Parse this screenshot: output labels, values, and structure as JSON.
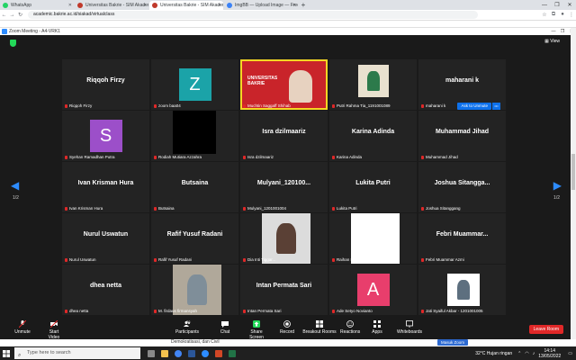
{
  "browser": {
    "tabs": [
      {
        "title": "WhatsApp",
        "color": "#25d366",
        "active": false
      },
      {
        "title": "Universitas Bakrie - SIM Akademi",
        "color": "#c0392b",
        "active": false
      },
      {
        "title": "Universitas Bakrie - SIM Akadem",
        "color": "#c0392b",
        "active": true
      },
      {
        "title": "ImgBB — Upload Image — Free",
        "color": "#3b82f6",
        "active": false
      }
    ],
    "url": "academic.bakrie.ac.id/siakad/virtualclass"
  },
  "zoom": {
    "window_title": "Zoom Meeting - A4-VRK1",
    "view_label": "View",
    "unmute_request_label": "Ask to Unmute",
    "page_left": "1/2",
    "page_right": "1/2",
    "participants": [
      {
        "big": "Riqqoh Firzy",
        "label": "Riqqoh Firzy"
      },
      {
        "big": "",
        "label": "zoom baa04",
        "avatar": "Z",
        "avatar_color": "#1ba3a8"
      },
      {
        "big": "",
        "label": "Muchtin Saggaff Shihab",
        "speaking": true,
        "banner": "UNIVERSITAS BAKRIE"
      },
      {
        "big": "",
        "label": "Putri Rahma Tia_1191001089"
      },
      {
        "big": "maharani k",
        "label": "maharani k"
      },
      {
        "big": "",
        "label": "Syehan Ramadhan Putra",
        "avatar": "S",
        "avatar_color": "#9c4fc9"
      },
      {
        "big": "",
        "label": "Rodiah Mutiara Azzahra"
      },
      {
        "big": "Isra dzilmaariz",
        "label": "Isra dzilmaariz"
      },
      {
        "big": "Karina Adinda",
        "label": "Karina Adinda"
      },
      {
        "big": "Muhammad Jihad",
        "label": "Muhammad Jihad"
      },
      {
        "big": "Ivan Krisman Hura",
        "label": "Ivan Krisman Hura"
      },
      {
        "big": "Butsaina",
        "label": "Butsaina"
      },
      {
        "big": "Mulyani_120100...",
        "label": "Mulyani_1201001004"
      },
      {
        "big": "Lukita Putri",
        "label": "Lukita Putri"
      },
      {
        "big": "Joshua  Sitangga...",
        "label": "Joshua Sitanggang"
      },
      {
        "big": "Nurul Uswatun",
        "label": "Nurul Uswatun"
      },
      {
        "big": "Rafif Yusuf Radani",
        "label": "Rafif Yusuf Radani"
      },
      {
        "big": "",
        "label": "Dia Inti Tiggar..."
      },
      {
        "big": "",
        "label": "Raihan Fau... - 1181001008"
      },
      {
        "big": "Febri  Muammar...",
        "label": "Febri Muammar Azmi"
      },
      {
        "big": "dhea netta",
        "label": "dhea netta"
      },
      {
        "big": "",
        "label": "M. firdaus firmansyah"
      },
      {
        "big": "Intan Permata Sari",
        "label": "Intan Permata Sari"
      },
      {
        "big": "",
        "label": "Ade Setyo Novianto",
        "avatar": "A",
        "avatar_color": "#e83e6c"
      },
      {
        "big": "",
        "label": "Jati Syaiful Akbar - 1201001005"
      }
    ],
    "toolbar": {
      "unmute": "Unmute",
      "start_video": "Start Video",
      "participants": "Participants",
      "participants_count": "26",
      "chat": "Chat",
      "share_screen": "Share Screen",
      "record": "Record",
      "breakout_rooms": "Breakout Rooms",
      "reactions": "Reactions",
      "apps": "Apps",
      "whiteboards": "Whiteboards",
      "leave": "Leave Room"
    }
  },
  "page": {
    "snippet": "Demokratisasi, dan Civil",
    "button": "Masuk Zoom"
  },
  "taskbar": {
    "search_placeholder": "Type here to search",
    "weather": "32°C  Hujan ringan",
    "time": "14:14",
    "date": "13/05/2022"
  }
}
